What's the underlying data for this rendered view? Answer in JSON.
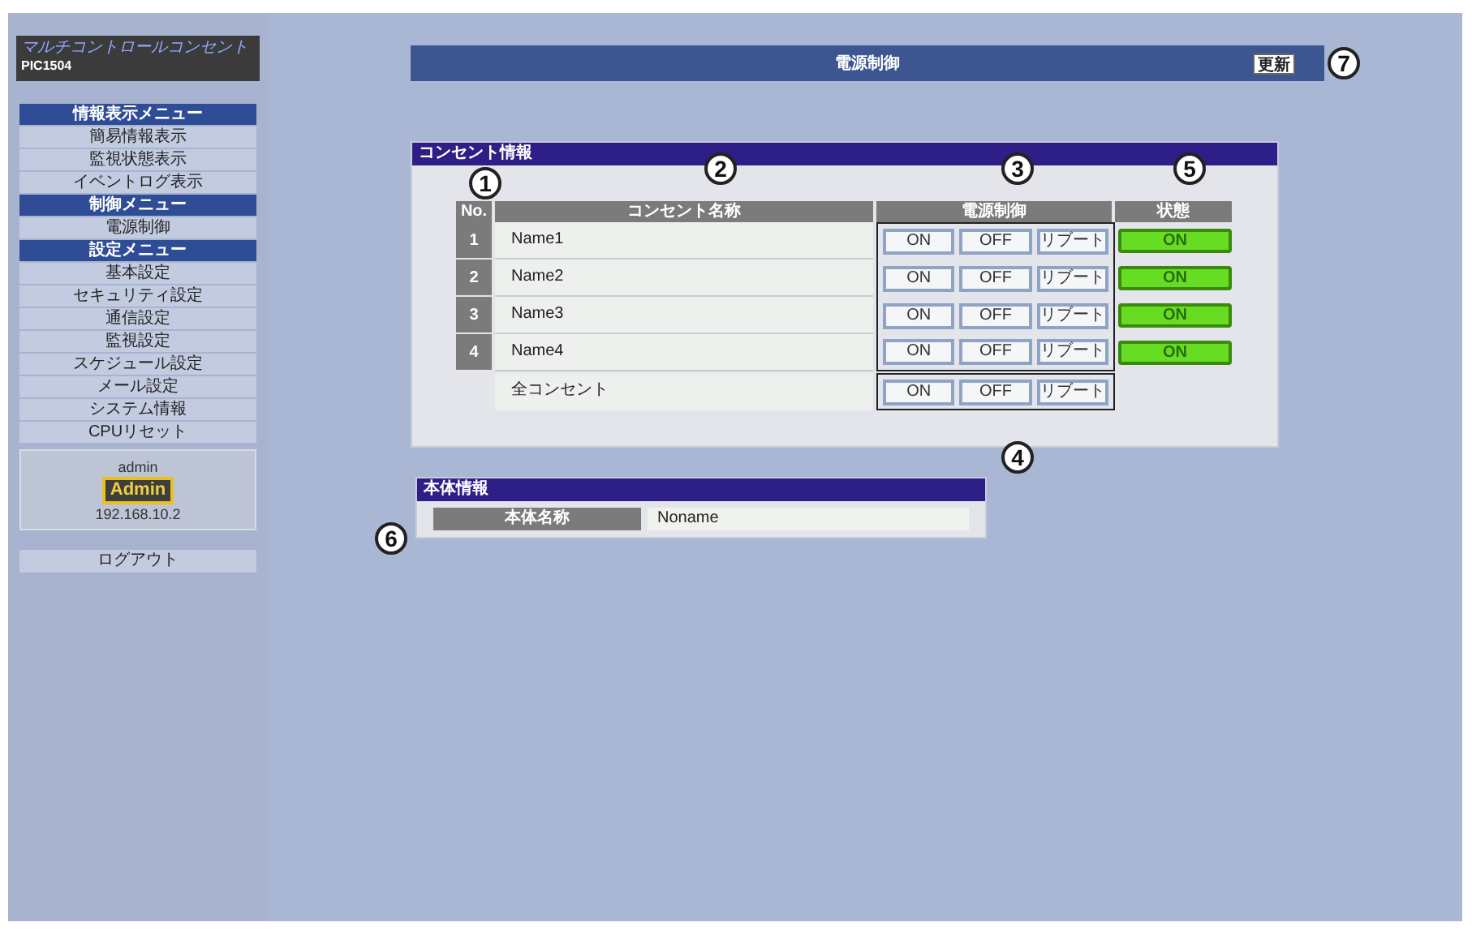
{
  "sidebar": {
    "logo": {
      "title": "マルチコントロールコンセント",
      "model": "PIC1504"
    },
    "menu": [
      {
        "kind": "header",
        "label": "情報表示メニュー"
      },
      {
        "kind": "item",
        "label": "簡易情報表示"
      },
      {
        "kind": "item",
        "label": "監視状態表示"
      },
      {
        "kind": "item",
        "label": "イベントログ表示"
      },
      {
        "kind": "header",
        "label": "制御メニュー"
      },
      {
        "kind": "item",
        "label": "電源制御"
      },
      {
        "kind": "header",
        "label": "設定メニュー"
      },
      {
        "kind": "item",
        "label": "基本設定"
      },
      {
        "kind": "item",
        "label": "セキュリティ設定"
      },
      {
        "kind": "item",
        "label": "通信設定"
      },
      {
        "kind": "item",
        "label": "監視設定"
      },
      {
        "kind": "item",
        "label": "スケジュール設定"
      },
      {
        "kind": "item",
        "label": "メール設定"
      },
      {
        "kind": "item",
        "label": "システム情報"
      },
      {
        "kind": "item",
        "label": "CPUリセット"
      }
    ],
    "user": {
      "name": "admin",
      "role": "Admin",
      "ip": "192.168.10.2"
    },
    "logout": "ログアウト"
  },
  "title_bar": {
    "title": "電源制御",
    "refresh": "更新"
  },
  "outlet_panel": {
    "title": "コンセント情報",
    "columns": [
      "No.",
      "コンセント名称",
      "電源制御",
      "状態"
    ],
    "rows": [
      {
        "no": "1",
        "name": "Name1",
        "buttons": [
          "ON",
          "OFF",
          "リブート"
        ],
        "status": "ON",
        "on": true
      },
      {
        "no": "2",
        "name": "Name2",
        "buttons": [
          "ON",
          "OFF",
          "リブート"
        ],
        "status": "ON",
        "on": true
      },
      {
        "no": "3",
        "name": "Name3",
        "buttons": [
          "ON",
          "OFF",
          "リブート"
        ],
        "status": "ON",
        "on": true
      },
      {
        "no": "4",
        "name": "Name4",
        "buttons": [
          "ON",
          "OFF",
          "リブート"
        ],
        "status": "ON",
        "on": true
      }
    ],
    "all_row": {
      "name": "全コンセント",
      "buttons": [
        "ON",
        "OFF",
        "リブート"
      ]
    }
  },
  "device_panel": {
    "title": "本体情報",
    "label": "本体名称",
    "value": "Noname"
  },
  "callouts": [
    "7",
    "1",
    "2",
    "3",
    "5",
    "4",
    "6"
  ]
}
